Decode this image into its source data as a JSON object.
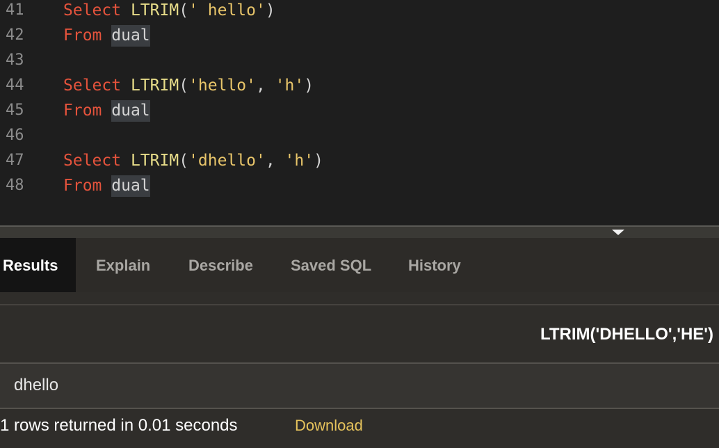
{
  "editor": {
    "lines": [
      {
        "number": "41",
        "keyword": "Select",
        "function": "LTRIM",
        "open": "(",
        "arg1": "' hello'",
        "sep": "",
        "arg2": "",
        "close": ")"
      },
      {
        "number": "42",
        "keyword": "From",
        "table": "dual"
      },
      {
        "number": "43"
      },
      {
        "number": "44",
        "keyword": "Select",
        "function": "LTRIM",
        "open": "(",
        "arg1": "'hello'",
        "sep": ", ",
        "arg2": "'h'",
        "close": ")"
      },
      {
        "number": "45",
        "keyword": "From",
        "table": "dual"
      },
      {
        "number": "46"
      },
      {
        "number": "47",
        "keyword": "Select",
        "function": "LTRIM",
        "open": "(",
        "arg1": "'dhello'",
        "sep": ", ",
        "arg2": "'h'",
        "close": ")"
      },
      {
        "number": "48",
        "keyword": "From",
        "table": "dual"
      }
    ]
  },
  "tabs": [
    {
      "label": "Results",
      "active": true
    },
    {
      "label": "Explain"
    },
    {
      "label": "Describe"
    },
    {
      "label": "Saved SQL"
    },
    {
      "label": "History"
    }
  ],
  "results": {
    "column_header": "LTRIM('DHELLO','HE')",
    "rows": [
      [
        "dhello"
      ]
    ],
    "status": "1 rows returned in 0.01 seconds",
    "download_label": "Download"
  },
  "colors": {
    "keyword": "#e5533c",
    "function": "#e8dd8a",
    "string": "#e8c56a",
    "link": "#e6c35c",
    "active_tab_bg": "#141414"
  }
}
